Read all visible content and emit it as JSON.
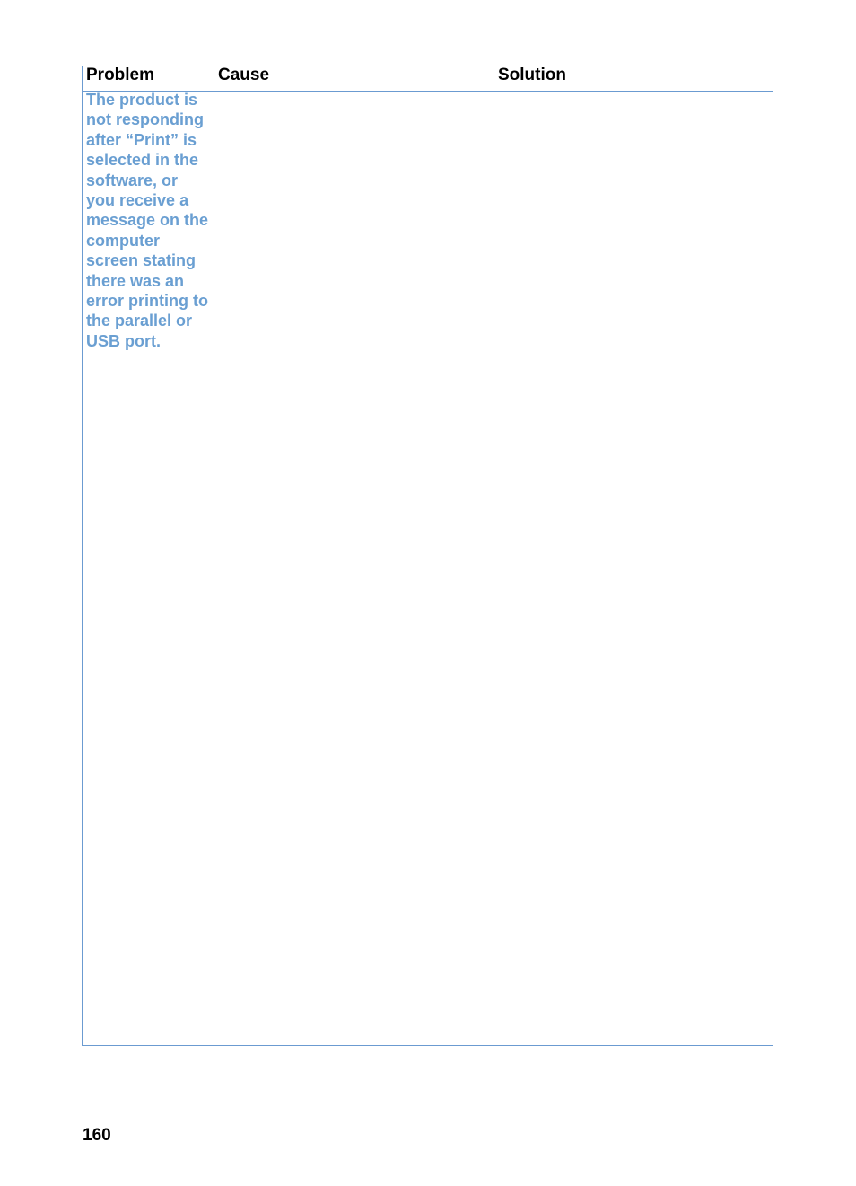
{
  "table": {
    "headers": [
      "Problem",
      "Cause",
      "Solution"
    ],
    "rows": [
      {
        "problem": "The product is not responding after “Print” is selected in the software, or you receive a message on the computer screen stating there was an error printing to the parallel or USB port.",
        "problem_lines": [
          "The product is",
          "not responding",
          "after “Print” is",
          "selected in the",
          "software, or",
          "you receive a",
          "message on the",
          "computer",
          "screen stating",
          "there was an",
          "error printing to",
          "the parallel or",
          "USB port."
        ],
        "cause": "",
        "solution": ""
      }
    ]
  },
  "colors": {
    "border": "#6b9bd1",
    "problem_text": "#6a9fd2"
  },
  "page_number": "160"
}
